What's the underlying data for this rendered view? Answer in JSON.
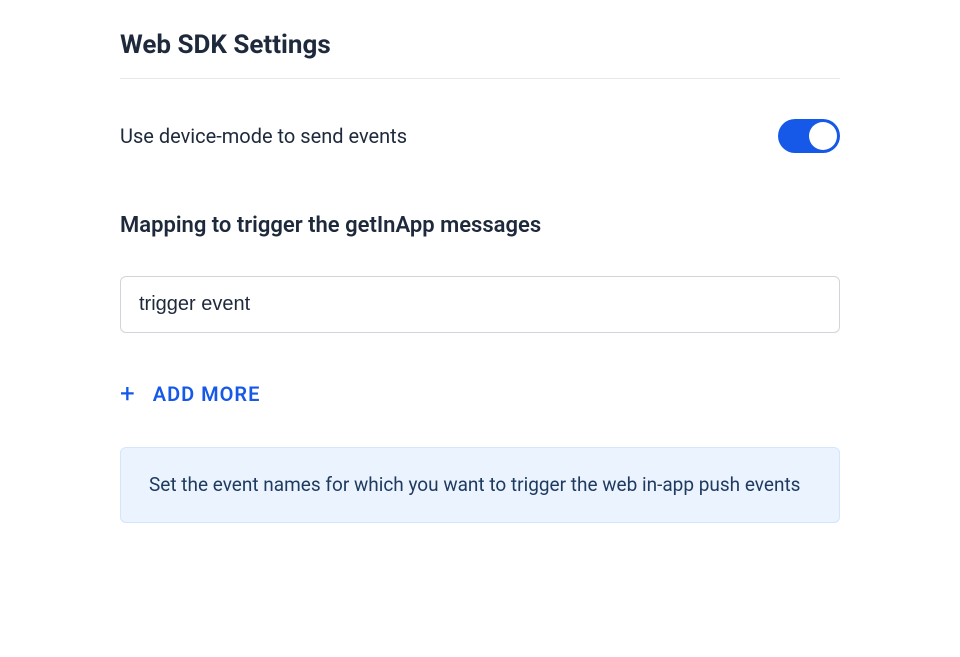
{
  "section": {
    "title": "Web SDK Settings"
  },
  "toggle": {
    "label": "Use device-mode to send events",
    "enabled": true
  },
  "mapping": {
    "label": "Mapping to trigger the getInApp messages",
    "input_value": "trigger event"
  },
  "add_more": {
    "label": "ADD MORE"
  },
  "info": {
    "text": "Set the event names for which you want to trigger the web in-app push events"
  }
}
